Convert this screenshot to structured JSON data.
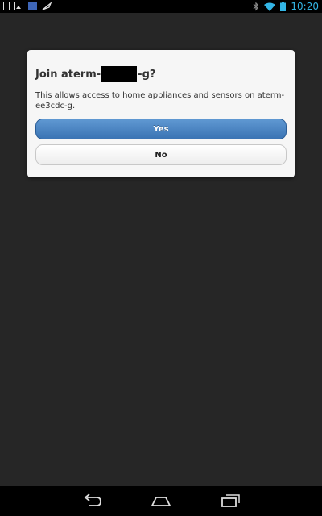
{
  "status_bar": {
    "time": "10:20",
    "left_icons": [
      "sim-card-icon",
      "gallery-icon",
      "app-notification-icon",
      "feather-icon"
    ],
    "right_icons": [
      "bluetooth-muted-icon",
      "wifi-icon",
      "battery-icon"
    ],
    "accent_color": "#33b5e5"
  },
  "dialog": {
    "title_prefix": "Join aterm-",
    "title_suffix": "-g?",
    "message": "This allows access to home appliances and sensors on aterm-ee3cdc-g.",
    "yes_label": "Yes",
    "no_label": "No",
    "yes_color": "#4a86c5"
  },
  "nav_bar": {
    "buttons": [
      "back-icon",
      "home-icon",
      "recent-apps-icon"
    ]
  }
}
